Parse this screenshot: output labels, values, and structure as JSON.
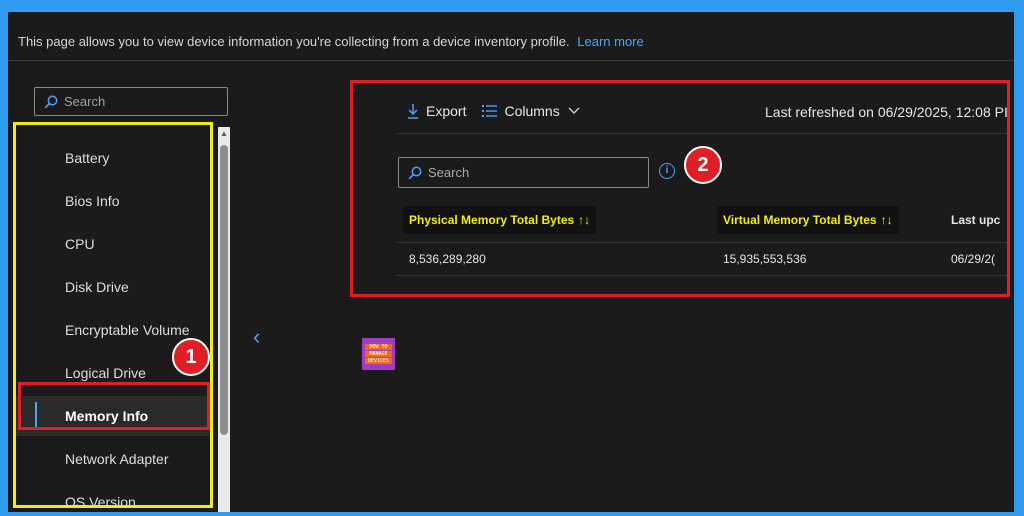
{
  "intro": {
    "text": "This page allows you to view device information you're collecting from a device inventory profile.",
    "link": "Learn more"
  },
  "sidebar": {
    "search_placeholder": "Search",
    "items": [
      {
        "label": "Battery"
      },
      {
        "label": "Bios Info"
      },
      {
        "label": "CPU"
      },
      {
        "label": "Disk Drive"
      },
      {
        "label": "Encryptable Volume"
      },
      {
        "label": "Logical Drive"
      },
      {
        "label": "Memory Info",
        "selected": true
      },
      {
        "label": "Network Adapter"
      },
      {
        "label": "OS Version"
      }
    ]
  },
  "toolbar": {
    "export_label": "Export",
    "columns_label": "Columns",
    "last_refreshed": "Last refreshed on 06/29/2025, 12:08 PI"
  },
  "grid": {
    "search_placeholder": "Search",
    "columns": [
      {
        "label": "Physical Memory Total Bytes",
        "sort": "↑↓"
      },
      {
        "label": "Virtual Memory Total Bytes",
        "sort": "↑↓"
      },
      {
        "label": "Last upc"
      }
    ],
    "rows": [
      [
        "8,536,289,280",
        "15,935,553,536",
        "06/29/2("
      ]
    ]
  },
  "annotations": {
    "badge_1": "1",
    "badge_2": "2"
  },
  "logo": {
    "lines": [
      "HOW TO",
      "MANAGE",
      "DEVICES"
    ]
  },
  "colors": {
    "highlight_yellow": "#f3ea1d",
    "annotation_red": "#e01e25",
    "accent_blue": "#4fa3f7"
  }
}
